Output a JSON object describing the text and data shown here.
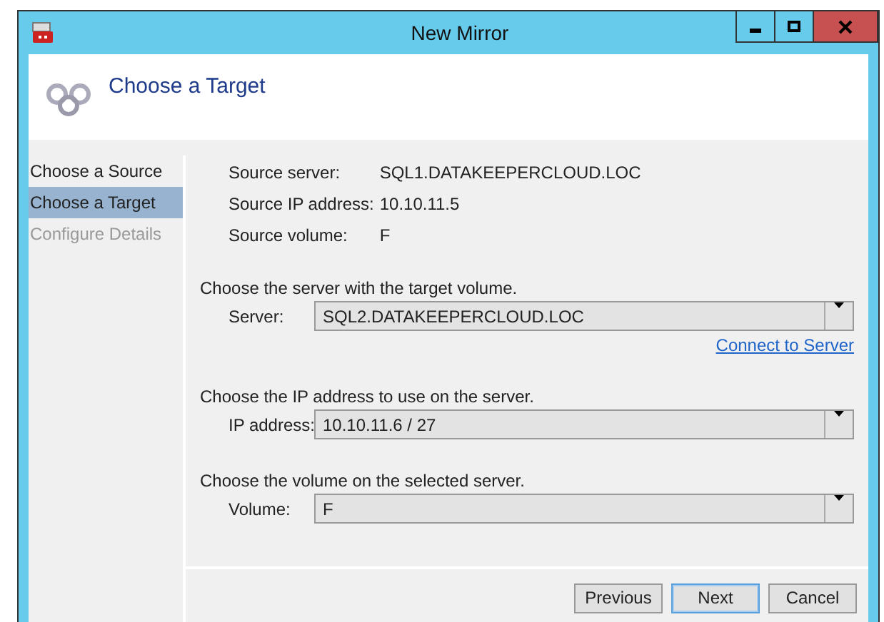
{
  "window": {
    "title": "New Mirror"
  },
  "header": {
    "title": "Choose a Target"
  },
  "steps": [
    {
      "label": "Choose a Source",
      "selected": false,
      "disabled": false
    },
    {
      "label": "Choose a Target",
      "selected": true,
      "disabled": false
    },
    {
      "label": "Configure Details",
      "selected": false,
      "disabled": true
    }
  ],
  "source_info": [
    {
      "label": "Source server:",
      "value": "SQL1.DATAKEEPERCLOUD.LOC"
    },
    {
      "label": "Source IP address:",
      "value": "10.10.11.5"
    },
    {
      "label": "Source volume:",
      "value": "F"
    }
  ],
  "sections": [
    {
      "prompt": "Choose the server with the target volume.",
      "label": "Server:",
      "value": "SQL2.DATAKEEPERCLOUD.LOC",
      "link": "Connect to Server"
    },
    {
      "prompt": "Choose the IP address to use on the server.",
      "label": "IP address:",
      "value": "10.10.11.6 / 27"
    },
    {
      "prompt": "Choose the volume on the selected server.",
      "label": "Volume:",
      "value": "F"
    }
  ],
  "buttons": [
    {
      "label": "Previous",
      "default": false
    },
    {
      "label": "Next",
      "default": true
    },
    {
      "label": "Cancel",
      "default": false
    }
  ]
}
